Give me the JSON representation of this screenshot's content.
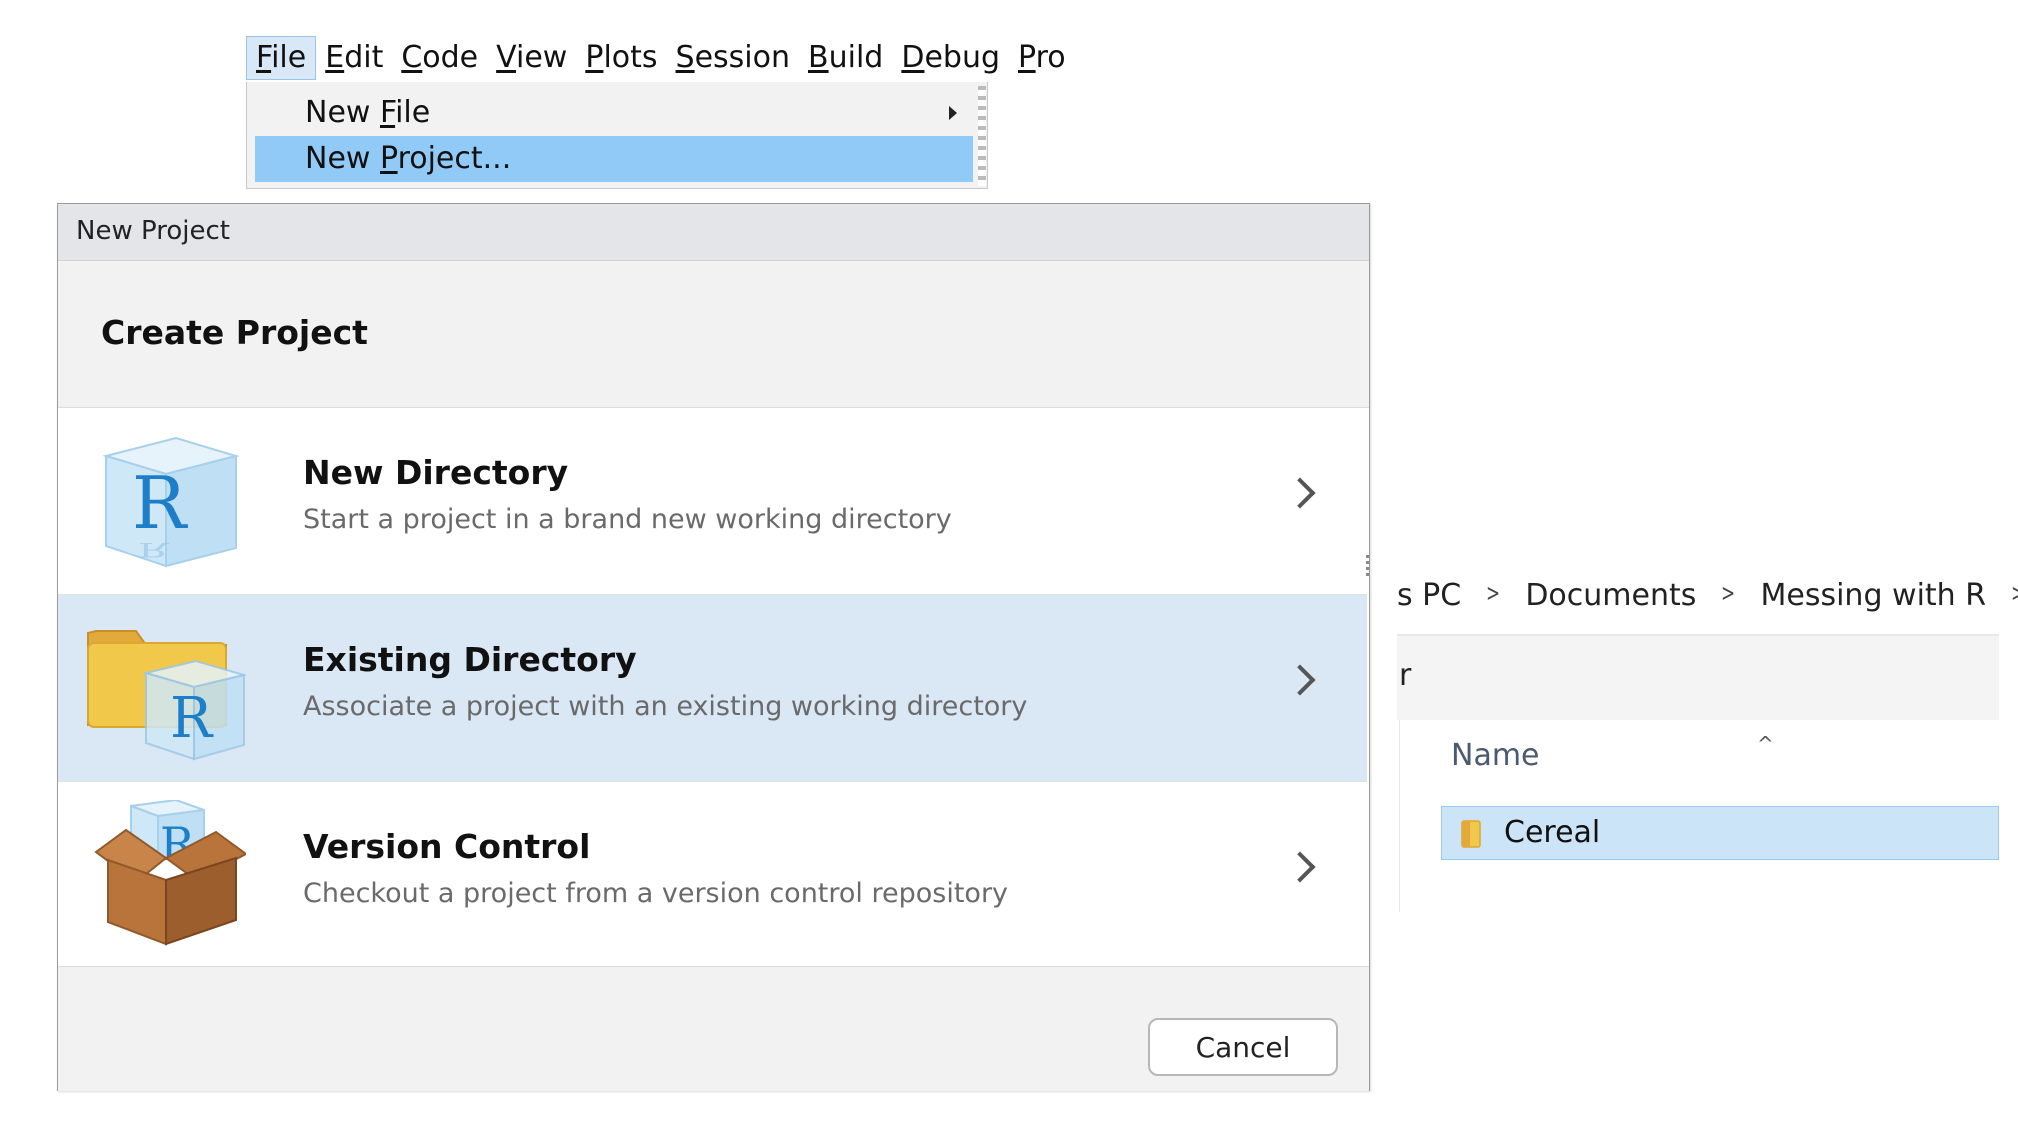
{
  "menubar": {
    "items": [
      {
        "pre": "",
        "key": "F",
        "post": "ile"
      },
      {
        "pre": "",
        "key": "E",
        "post": "dit"
      },
      {
        "pre": "",
        "key": "C",
        "post": "ode"
      },
      {
        "pre": "",
        "key": "V",
        "post": "iew"
      },
      {
        "pre": "",
        "key": "P",
        "post": "lots"
      },
      {
        "pre": "",
        "key": "S",
        "post": "ession"
      },
      {
        "pre": "",
        "key": "B",
        "post": "uild"
      },
      {
        "pre": "",
        "key": "D",
        "post": "ebug"
      },
      {
        "pre": "",
        "key": "P",
        "post": "ro"
      }
    ]
  },
  "file_menu": {
    "new_file": {
      "pre": "New ",
      "key": "F",
      "post": "ile"
    },
    "new_project": {
      "pre": "New ",
      "key": "P",
      "post": "roject..."
    }
  },
  "dialog": {
    "title": "New Project",
    "header": "Create Project",
    "options": [
      {
        "title": "New Directory",
        "description": "Start a project in a brand new working directory"
      },
      {
        "title": "Existing Directory",
        "description": "Associate a project with an existing working directory"
      },
      {
        "title": "Version Control",
        "description": "Checkout a project from a version control repository"
      }
    ],
    "cancel_label": "Cancel"
  },
  "explorer": {
    "breadcrumb": [
      "s PC",
      "Documents",
      "Messing with R"
    ],
    "breadcrumb_sep": ">",
    "toolbar_fragment": "r",
    "sort_indicator": "^",
    "column_name": "Name",
    "files": [
      {
        "name": "Cereal",
        "icon": "folder-icon"
      }
    ]
  },
  "colors": {
    "menu_selected": "#91c9f7",
    "option_highlight": "#dae7f5",
    "explorer_selected": "#cce4f7",
    "r_logo_blue": "#1e7fc8",
    "box_brown": "#b8743a",
    "folder_yellow": "#f2c84b"
  }
}
